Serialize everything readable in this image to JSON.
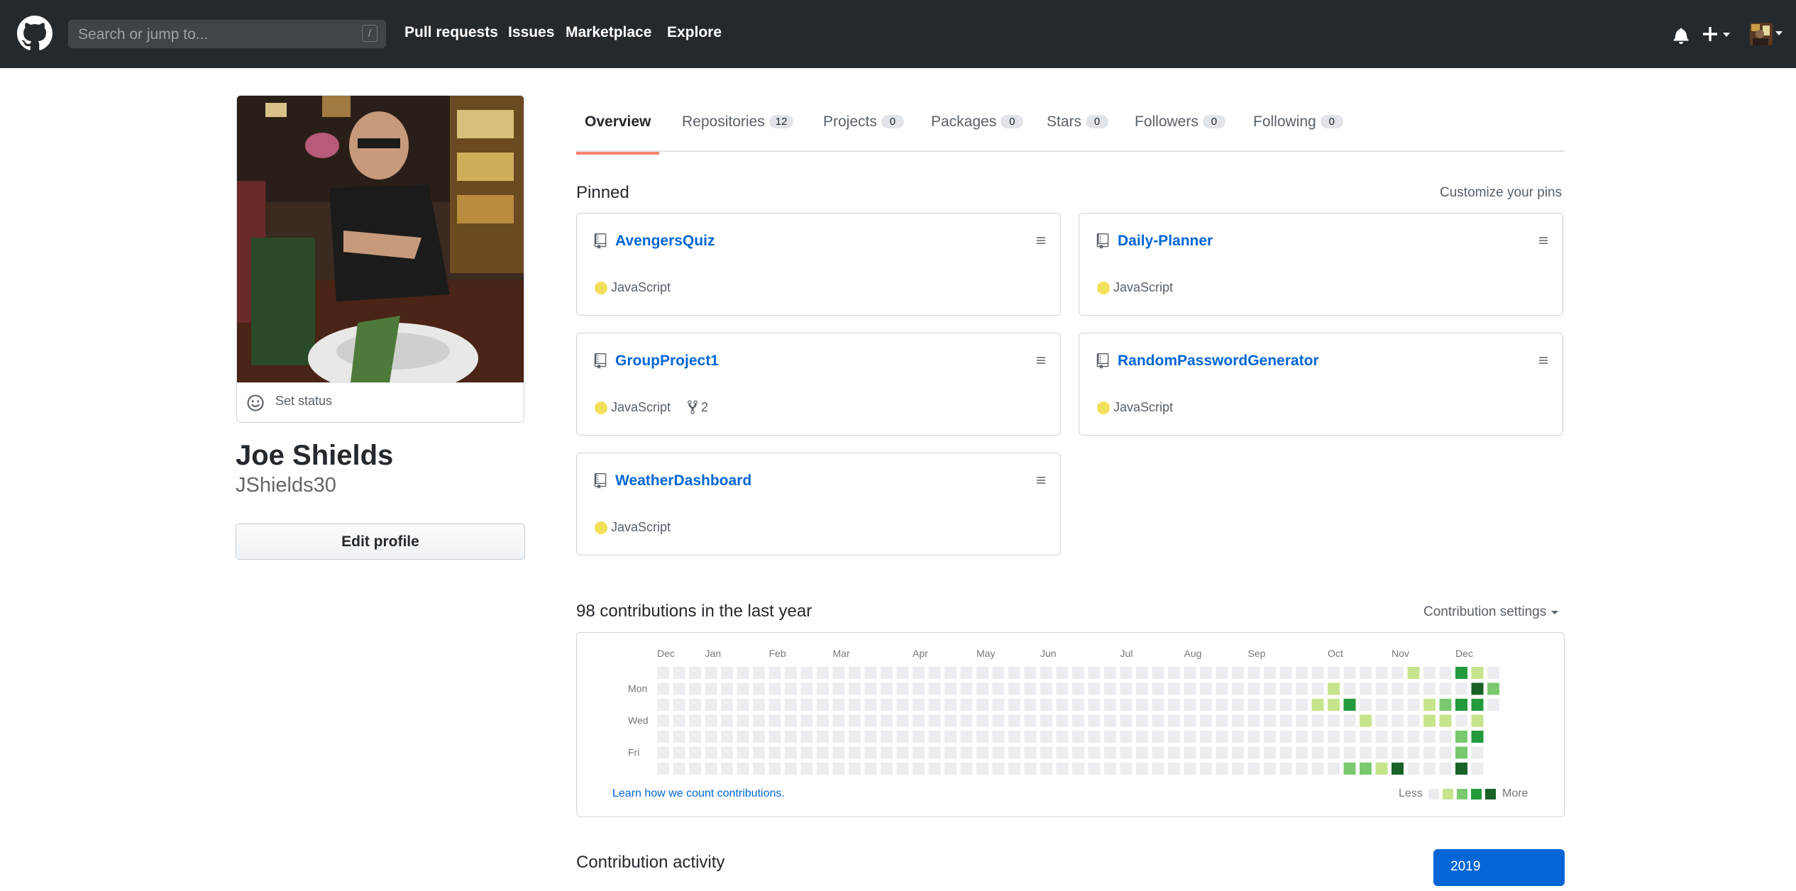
{
  "header": {
    "search_placeholder": "Search or jump to...",
    "search_shortcut": "/",
    "nav": [
      "Pull requests",
      "Issues",
      "Marketplace",
      "Explore"
    ]
  },
  "profile": {
    "set_status": "Set status",
    "name": "Joe Shields",
    "login": "JShields30",
    "edit_profile": "Edit profile"
  },
  "tabs": [
    {
      "label": "Overview",
      "count": null,
      "active": true
    },
    {
      "label": "Repositories",
      "count": "12"
    },
    {
      "label": "Projects",
      "count": "0"
    },
    {
      "label": "Packages",
      "count": "0"
    },
    {
      "label": "Stars",
      "count": "0"
    },
    {
      "label": "Followers",
      "count": "0"
    },
    {
      "label": "Following",
      "count": "0"
    }
  ],
  "pinned": {
    "heading": "Pinned",
    "customize": "Customize your pins",
    "repos": [
      {
        "name": "AvengersQuiz",
        "language": "JavaScript",
        "forks": null
      },
      {
        "name": "Daily-Planner",
        "language": "JavaScript",
        "forks": null
      },
      {
        "name": "GroupProject1",
        "language": "JavaScript",
        "forks": "2"
      },
      {
        "name": "RandomPasswordGenerator",
        "language": "JavaScript",
        "forks": null
      },
      {
        "name": "WeatherDashboard",
        "language": "JavaScript",
        "forks": null
      }
    ],
    "language_color": "#f1e05a"
  },
  "contributions": {
    "heading": "98 contributions in the last year",
    "settings": "Contribution settings",
    "months": [
      "Dec",
      "Jan",
      "Feb",
      "Mar",
      "Apr",
      "May",
      "Jun",
      "Jul",
      "Aug",
      "Sep",
      "Oct",
      "Nov",
      "Dec"
    ],
    "weekdays": [
      "Mon",
      "Wed",
      "Fri"
    ],
    "learn_link": "Learn how we count contributions.",
    "legend_less": "Less",
    "legend_more": "More",
    "colors": [
      "#ebedf0",
      "#c6e48b",
      "#7bc96f",
      "#239a3b",
      "#196127"
    ],
    "nonzero_cells": [
      [
        43,
        6,
        2
      ],
      [
        44,
        6,
        2
      ],
      [
        45,
        6,
        1
      ],
      [
        46,
        6,
        4
      ],
      [
        42,
        1,
        1
      ],
      [
        42,
        2,
        1
      ],
      [
        41,
        2,
        1
      ],
      [
        43,
        2,
        3
      ],
      [
        47,
        0,
        1
      ],
      [
        48,
        2,
        1
      ],
      [
        48,
        3,
        1
      ],
      [
        44,
        3,
        1
      ],
      [
        49,
        2,
        2
      ],
      [
        49,
        3,
        1
      ],
      [
        50,
        0,
        3
      ],
      [
        50,
        2,
        3
      ],
      [
        50,
        4,
        2
      ],
      [
        50,
        5,
        2
      ],
      [
        50,
        6,
        4
      ],
      [
        51,
        0,
        1
      ],
      [
        51,
        1,
        4
      ],
      [
        51,
        2,
        3
      ],
      [
        51,
        3,
        1
      ],
      [
        51,
        4,
        3
      ],
      [
        52,
        1,
        2
      ]
    ]
  },
  "activity": {
    "heading": "Contribution activity",
    "year": "2019"
  }
}
